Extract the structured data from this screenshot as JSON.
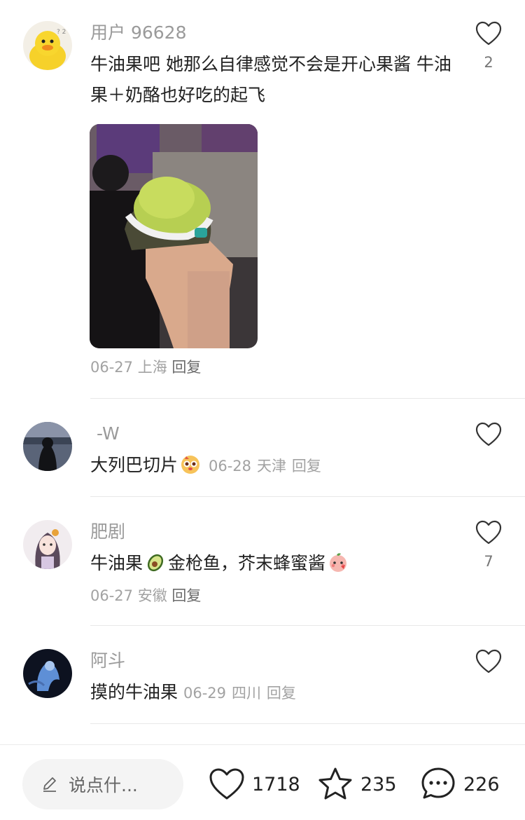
{
  "comments": [
    {
      "user": "用户 96628",
      "text": "牛油果吧 她那么自律感觉不会是开心果酱 牛油果＋奶酪也好吃的起飞",
      "date": "06-27",
      "location": "上海",
      "reply": "回复",
      "likes": "2",
      "avatar": "yellow-duck-avatar"
    },
    {
      "user": "-W",
      "text": "大列巴切片",
      "emoji": "cute-face-emoji",
      "date": "06-28",
      "location": "天津",
      "reply": "回复",
      "likes": "",
      "avatar": "dark-silhouette-avatar"
    },
    {
      "user": "肥剧",
      "text_a": "牛油果",
      "emoji_a": "avocado-emoji",
      "text_b": "金枪鱼，芥末蜂蜜酱",
      "emoji_b": "peach-face-emoji",
      "date": "06-27",
      "location": "安徽",
      "reply": "回复",
      "likes": "7",
      "avatar": "anime-girl-avatar"
    },
    {
      "user": "阿斗",
      "text": "摸的牛油果",
      "date": "06-29",
      "location": "四川",
      "reply": "回复",
      "likes": "",
      "avatar": "blue-figure-avatar"
    }
  ],
  "bottom_bar": {
    "input_placeholder": "说点什...",
    "likes": "1718",
    "favorites": "235",
    "comments": "226"
  },
  "colors": {
    "text": "#222222",
    "secondary": "#9a9a9a",
    "divider": "#e8e8e8",
    "input_bg": "#f4f4f4"
  }
}
